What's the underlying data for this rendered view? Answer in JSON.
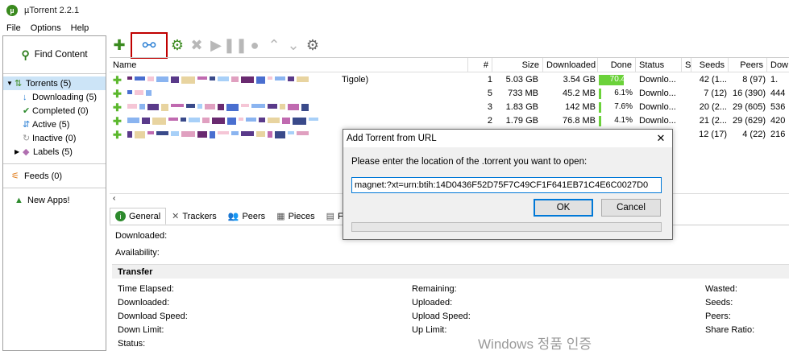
{
  "window": {
    "title": "µTorrent 2.2.1",
    "logo": "µ"
  },
  "menu": [
    "File",
    "Options",
    "Help"
  ],
  "sidebar": {
    "find": "Find Content",
    "torrents": "Torrents (5)",
    "downloading": "Downloading (5)",
    "completed": "Completed (0)",
    "active": "Active (5)",
    "inactive": "Inactive (0)",
    "labels": "Labels (5)",
    "feeds": "Feeds (0)",
    "apps": "New Apps!"
  },
  "columns": {
    "name": "Name",
    "num": "#",
    "size": "Size",
    "downloaded": "Downloaded",
    "done": "Done",
    "status": "Status",
    "s": "S",
    "seeds": "Seeds",
    "peers": "Peers",
    "down": "Dow"
  },
  "rows": [
    {
      "name_tail": "Tigole)",
      "num": "1",
      "size": "5.03 GB",
      "downloaded": "3.54 GB",
      "done": "70.4%",
      "progress": 0.704,
      "status": "Downlo...",
      "seeds": "42 (1...",
      "peers": "8 (97)",
      "down": "1."
    },
    {
      "name_tail": "",
      "num": "5",
      "size": "733 MB",
      "downloaded": "45.2 MB",
      "done": "6.1%",
      "progress": 0.061,
      "status": "Downlo...",
      "seeds": "7 (12)",
      "peers": "16 (390)",
      "down": "444"
    },
    {
      "name_tail": "",
      "num": "3",
      "size": "1.83 GB",
      "downloaded": "142 MB",
      "done": "7.6%",
      "progress": 0.076,
      "status": "Downlo...",
      "seeds": "20 (2...",
      "peers": "29 (605)",
      "down": "536"
    },
    {
      "name_tail": "",
      "num": "2",
      "size": "1.79 GB",
      "downloaded": "76.8 MB",
      "done": "4.1%",
      "progress": 0.041,
      "status": "Downlo...",
      "seeds": "21 (2...",
      "peers": "29 (629)",
      "down": "420"
    },
    {
      "name_tail": "",
      "num": "",
      "size": "",
      "downloaded": "",
      "done": "",
      "progress": 0.0,
      "status": "",
      "seeds": "12 (17)",
      "peers": "4 (22)",
      "down": "216"
    }
  ],
  "dialog": {
    "title": "Add Torrent from URL",
    "close": "✕",
    "prompt": "Please enter the location of the .torrent you want to open:",
    "url": "magnet:?xt=urn:btih:14D0436F52D75F7C49CF1F641EB71C4E6C0027D0",
    "ok": "OK",
    "cancel": "Cancel"
  },
  "tabs": [
    "General",
    "Trackers",
    "Peers",
    "Pieces",
    "Files"
  ],
  "general": {
    "downloaded": "Downloaded:",
    "availability": "Availability:"
  },
  "transfer": {
    "title": "Transfer",
    "col1": [
      "Time Elapsed:",
      "Downloaded:",
      "Download Speed:",
      "Down Limit:",
      "Status:"
    ],
    "col2": [
      "Remaining:",
      "Uploaded:",
      "Upload Speed:",
      "Up Limit:"
    ],
    "col3": [
      "Wasted:",
      "Seeds:",
      "Peers:",
      "Share Ratio:"
    ]
  },
  "watermark": "Windows 정품 인증",
  "colors": {
    "accent": "#3a8a1e",
    "progress": "#6bd23a",
    "highlight": "#c00000"
  }
}
